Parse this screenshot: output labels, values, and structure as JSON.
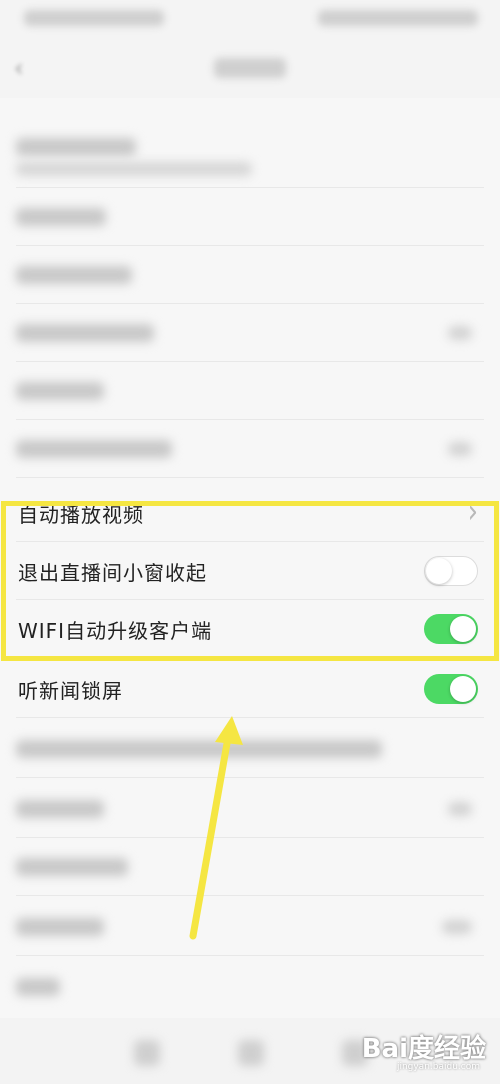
{
  "settings": {
    "rows": [
      {
        "label": "自动播放视频",
        "control": "chevron"
      },
      {
        "label": "退出直播间小窗收起",
        "control": "toggle",
        "on": false
      },
      {
        "label": "WIFI自动升级客户端",
        "control": "toggle",
        "on": true
      },
      {
        "label": "听新闻锁屏",
        "control": "toggle",
        "on": true
      }
    ]
  },
  "icons": {
    "chevron": "chevron-right-icon",
    "back": "back-arrow-icon"
  },
  "colors": {
    "toggle_on": "#4cd964",
    "highlight": "#f5e642",
    "arrow": "#f5e642"
  },
  "watermark": {
    "text": "Bai度经验",
    "sub": "jingyan.baidu.com"
  }
}
